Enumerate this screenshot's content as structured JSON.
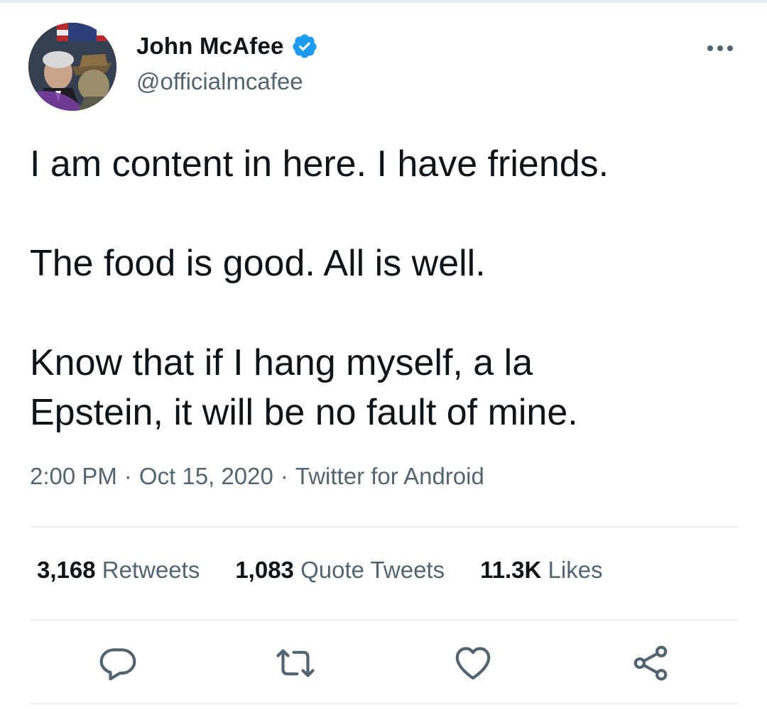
{
  "author": {
    "display_name": "John McAfee",
    "handle": "@officialmcafee",
    "verified": true
  },
  "tweet": {
    "text": "I am content in here. I have friends.\n\nThe food is good. All is well.\n\nKnow that if I hang myself, a la\nEpstein, it will be no fault of mine.",
    "time": "2:00 PM",
    "date": "Oct 15, 2020",
    "source": "Twitter for Android",
    "separator": "·"
  },
  "stats": {
    "retweets_count": "3,168",
    "retweets_label": "Retweets",
    "quotes_count": "1,083",
    "quotes_label": "Quote Tweets",
    "likes_count": "11.3K",
    "likes_label": "Likes"
  },
  "icons": {
    "more": "more-options-icon",
    "reply": "reply-icon",
    "retweet": "retweet-icon",
    "like": "like-icon",
    "share": "share-icon",
    "verified": "verified-badge-icon"
  },
  "colors": {
    "text": "#0f1419",
    "secondary": "#536471",
    "verified": "#1d9bf0",
    "divider": "#eceff1"
  }
}
